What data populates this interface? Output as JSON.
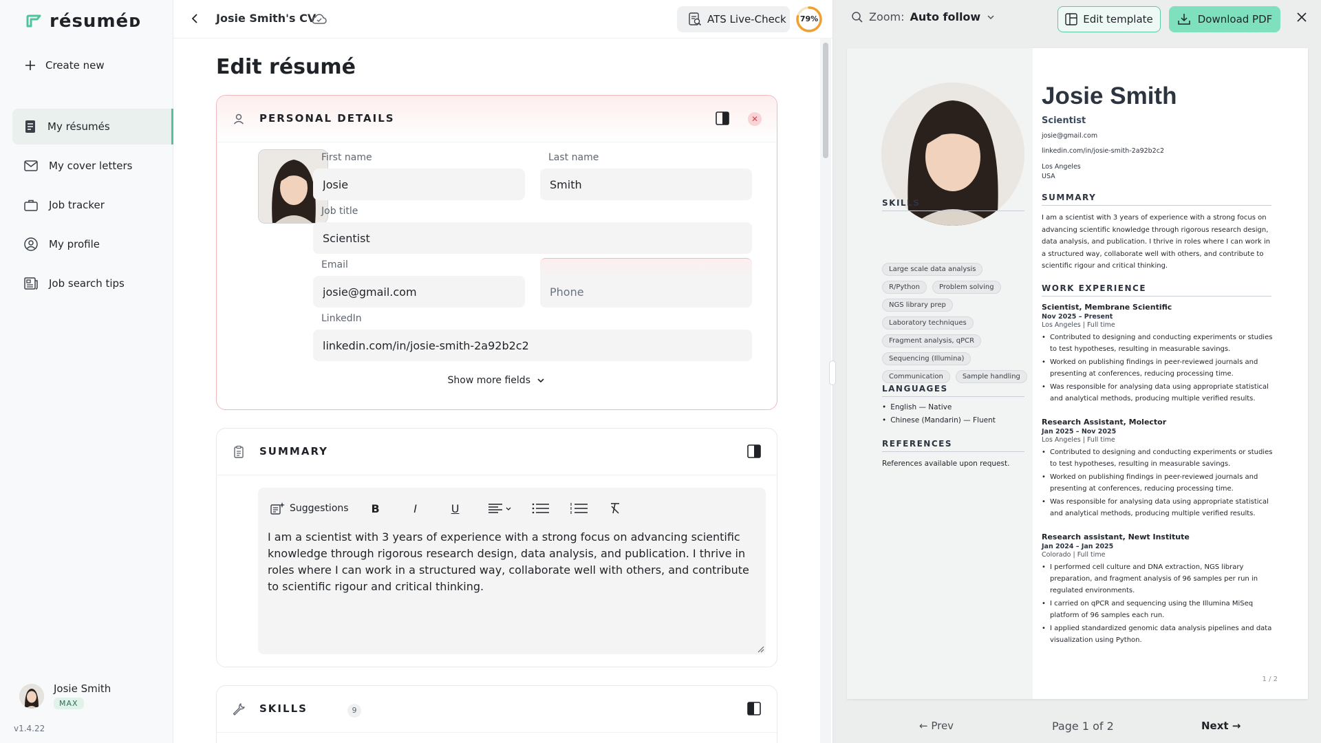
{
  "app": {
    "logo_text": "résuméᴅ",
    "version": "v1.4.22"
  },
  "sidebar": {
    "create_new": "Create new",
    "items": [
      {
        "label": "My résumés",
        "icon": "document-icon",
        "active": true
      },
      {
        "label": "My cover letters",
        "icon": "mail-icon"
      },
      {
        "label": "Job tracker",
        "icon": "briefcase-icon"
      },
      {
        "label": "My profile",
        "icon": "user-circle-icon"
      },
      {
        "label": "Job search tips",
        "icon": "newspaper-icon"
      }
    ],
    "user": {
      "name": "Josie Smith",
      "plan": "MAX"
    }
  },
  "editor": {
    "doc_title": "Josie Smith's CV",
    "ats_label": "ATS Live-Check",
    "ats_score": "79%",
    "ats_value": 0.79,
    "heading": "Edit résumé",
    "personal": {
      "title": "PERSONAL DETAILS",
      "first_name_label": "First name",
      "first_name": "Josie",
      "last_name_label": "Last name",
      "last_name": "Smith",
      "job_title_label": "Job title",
      "job_title": "Scientist",
      "email_label": "Email",
      "email": "josie@gmail.com",
      "phone_placeholder": "Phone",
      "linkedin_label": "LinkedIn",
      "linkedin": "linkedin.com/in/josie-smith-2a92b2c2",
      "show_more": "Show more fields"
    },
    "summary": {
      "title": "SUMMARY",
      "suggestions": "Suggestions",
      "text": "I am a scientist with 3 years of experience with a strong focus on advancing scientific knowledge through rigorous research design, data analysis, and publication. I thrive in roles where I can work in a structured way, collaborate well with others, and contribute to scientific rigour and critical thinking."
    },
    "skills": {
      "title": "SKILLS",
      "count": "9"
    }
  },
  "preview": {
    "zoom_label": "Zoom:",
    "zoom_value": "Auto follow",
    "edit_template": "Edit template",
    "download": "Download PDF",
    "resume": {
      "name": "Josie Smith",
      "role": "Scientist",
      "email": "josie@gmail.com",
      "linkedin": "linkedin.com/in/josie-smith-2a92b2c2",
      "city": "Los Angeles",
      "country": "USA",
      "skills_title": "SKILLS",
      "skills": [
        "Large scale data analysis",
        "R/Python",
        "Problem solving",
        "NGS library prep",
        "Laboratory techniques",
        "Fragment analysis, qPCR",
        "Sequencing (Illumina)",
        "Communication",
        "Sample handling"
      ],
      "languages_title": "LANGUAGES",
      "languages": [
        "English — Native",
        "Chinese (Mandarin) — Fluent"
      ],
      "references_title": "REFERENCES",
      "references": "References available upon request.",
      "summary_title": "SUMMARY",
      "summary": "I am a scientist with 3 years of experience with a strong focus on advancing scientific knowledge through rigorous research design, data analysis, and publication. I thrive in roles where I can work in a structured way, collaborate well with others, and contribute to scientific rigour and critical thinking.",
      "work_title": "WORK EXPERIENCE",
      "jobs": [
        {
          "title": "Scientist, Membrane Scientific",
          "date": "Nov 2025 – Present",
          "loc": "Los Angeles | Full time",
          "bullets": [
            "Contributed to designing and conducting experiments or studies to test hypotheses, resulting in measurable savings.",
            "Worked on publishing findings in peer-reviewed journals and presenting at conferences, reducing processing time.",
            "Was responsible for analysing data using appropriate statistical and analytical methods, producing multiple verified results."
          ]
        },
        {
          "title": "Research Assistant, Molector",
          "date": "Jan 2025 – Nov 2025",
          "loc": "Los Angeles | Full time",
          "bullets": [
            "Contributed to designing and conducting experiments or studies to test hypotheses, resulting in measurable savings.",
            "Worked on publishing findings in peer-reviewed journals and presenting at conferences, reducing processing time.",
            "Was responsible for analysing data using appropriate statistical and analytical methods, producing multiple verified results."
          ]
        },
        {
          "title": "Research assistant, Newt Institute",
          "date": "Jan 2024 – Jan 2025",
          "loc": "Colorado | Full time",
          "bullets": [
            "I performed cell culture and DNA extraction, NGS library preparation, and fragment analysis of 96 samples per run in regulated environments.",
            "I carried on qPCR and sequencing using the Illumina MiSeq platform of 96 samples each run.",
            "I applied standardized genomic data analysis pipelines and data visualization using Python."
          ]
        }
      ],
      "page_indicator": "1 / 2"
    },
    "pager": {
      "prev": "← Prev",
      "info": "Page 1 of 2",
      "next": "Next →"
    }
  },
  "colors": {
    "accent": "#4fc39a",
    "accent_light": "#7fe0bd",
    "alert": "#f0b8bb",
    "ats_ring": "#f0a030"
  }
}
